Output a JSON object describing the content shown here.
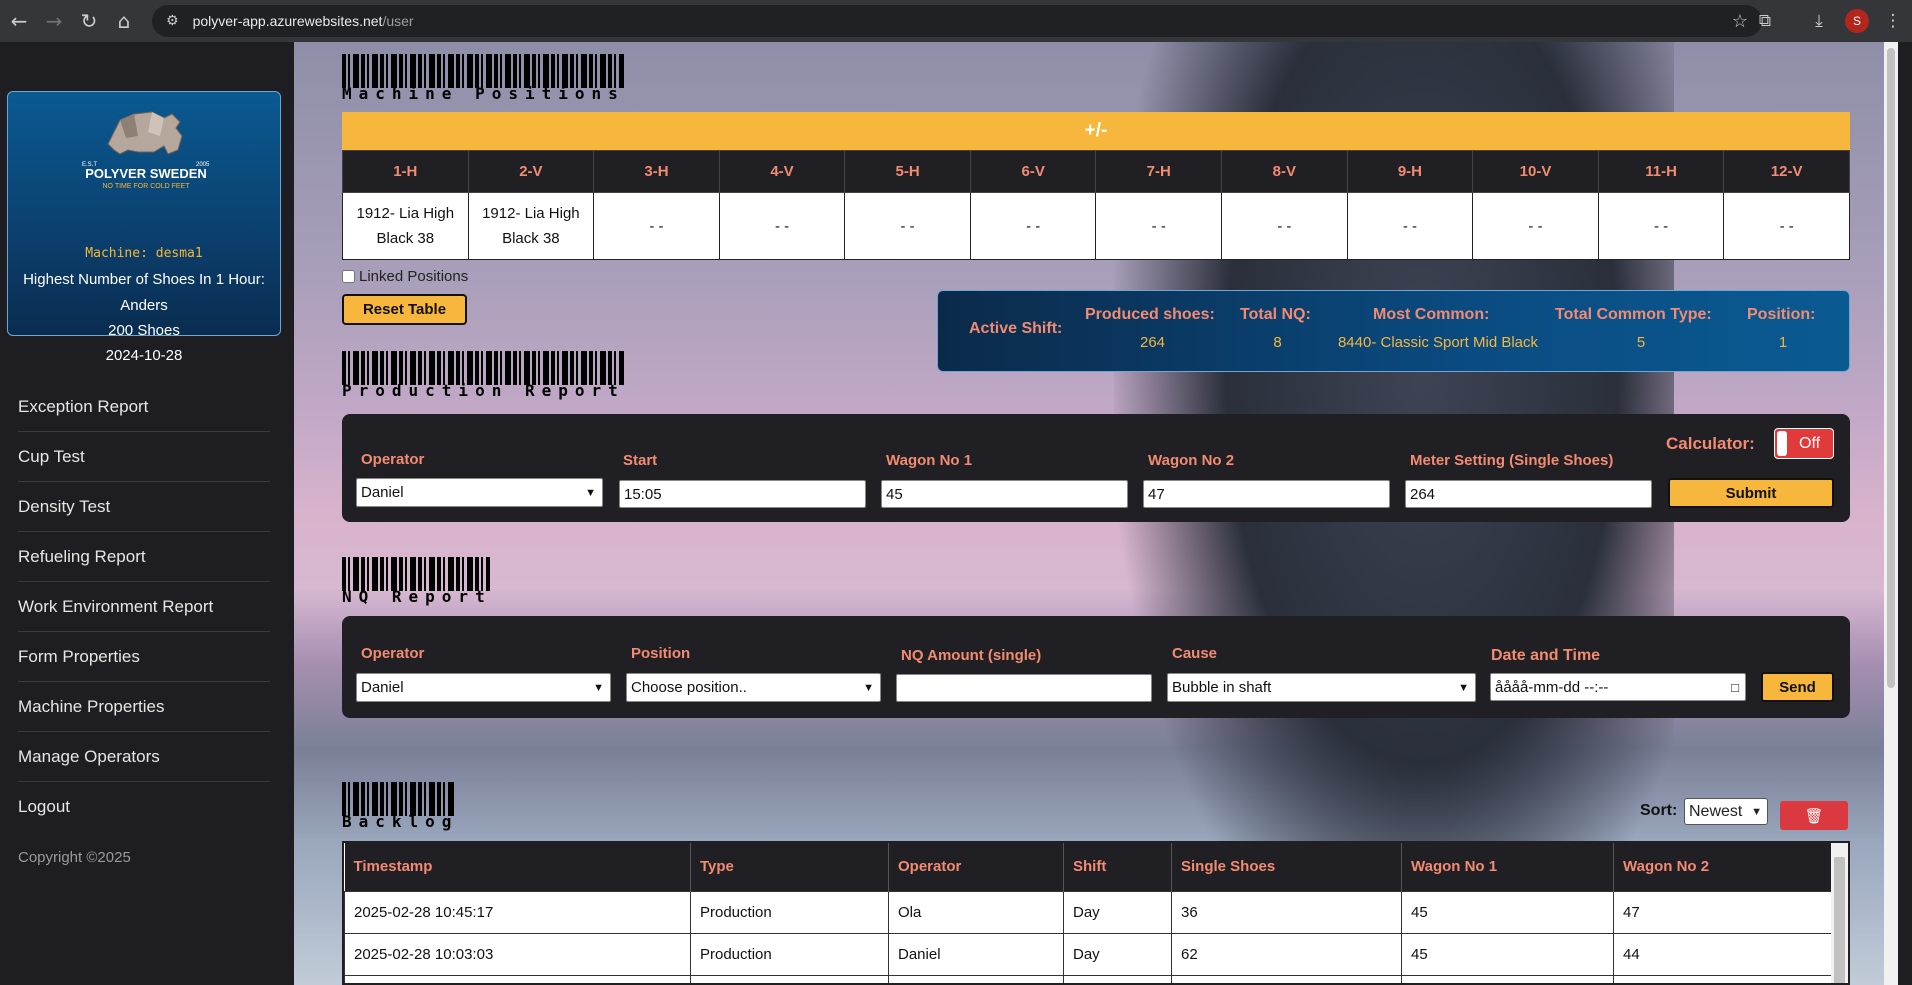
{
  "browser": {
    "url_host": "polyver-app.azurewebsites.net",
    "url_path": "/user",
    "profile_initial": "S"
  },
  "sidebar": {
    "logo_small_left": "E.S.T",
    "logo_small_right": "2005",
    "logo_text": "POLYVER SWEDEN",
    "logo_tagline": "NO TIME FOR COLD FEET",
    "machine": "Machine: desma1",
    "highscore_title": "Highest Number of Shoes In 1 Hour:",
    "highscore_name": "Anders",
    "highscore_count": "200 Shoes",
    "highscore_date": "2024-10-28",
    "menu": [
      "Exception Report",
      "Cup Test",
      "Density Test",
      "Refueling Report",
      "Work Environment Report",
      "Form Properties",
      "Machine Properties",
      "Manage Operators",
      "Logout"
    ],
    "copyright": "Copyright ©2025"
  },
  "machine_positions": {
    "heading": "Machine Positions",
    "toggle_label": "+/-",
    "columns": [
      "1-H",
      "2-V",
      "3-H",
      "4-V",
      "5-H",
      "6-V",
      "7-H",
      "8-V",
      "9-H",
      "10-V",
      "11-H",
      "12-V"
    ],
    "cells": [
      [
        "1912- Lia High",
        "Black 38"
      ],
      [
        "1912- Lia High",
        "Black 38"
      ],
      [
        "- -"
      ],
      [
        "- -"
      ],
      [
        "- -"
      ],
      [
        "- -"
      ],
      [
        "- -"
      ],
      [
        "- -"
      ],
      [
        "- -"
      ],
      [
        "- -"
      ],
      [
        "- -"
      ],
      [
        "- -"
      ]
    ],
    "linked_label": "Linked Positions",
    "reset_label": "Reset Table"
  },
  "active_shift": {
    "title": "Active Shift:",
    "produced_label": "Produced shoes:",
    "produced_value": "264",
    "nq_label": "Total NQ:",
    "nq_value": "8",
    "common_label": "Most Common:",
    "common_value": "8440- Classic Sport Mid Black",
    "common_type_label": "Total Common Type:",
    "common_type_value": "5",
    "position_label": "Position:",
    "position_value": "1"
  },
  "production": {
    "heading": "Production Report",
    "operator_label": "Operator",
    "operator_value": "Daniel",
    "start_label": "Start",
    "start_value": "15:05",
    "wagon1_label": "Wagon No 1",
    "wagon1_value": "45",
    "wagon2_label": "Wagon No 2",
    "wagon2_value": "47",
    "meter_label": "Meter Setting (Single Shoes)",
    "meter_value": "264",
    "calculator_label": "Calculator:",
    "calculator_state": "Off",
    "submit_label": "Submit"
  },
  "nq": {
    "heading": "NQ Report",
    "operator_label": "Operator",
    "operator_value": "Daniel",
    "position_label": "Position",
    "position_value": "Choose position..",
    "amount_label": "NQ Amount (single)",
    "amount_value": "",
    "cause_label": "Cause",
    "cause_value": "Bubble in shaft",
    "datetime_label": "Date and Time",
    "datetime_value": "åååå-mm-dd --:--",
    "send_label": "Send"
  },
  "backlog": {
    "heading": "Backlog",
    "sort_label": "Sort:",
    "sort_value": "Newest",
    "columns": [
      "Timestamp",
      "Type",
      "Operator",
      "Shift",
      "Single Shoes",
      "Wagon No 1",
      "Wagon No 2"
    ],
    "rows": [
      [
        "2025-02-28 10:45:17",
        "Production",
        "Ola",
        "Day",
        "36",
        "45",
        "47"
      ],
      [
        "2025-02-28 10:03:03",
        "Production",
        "Daniel",
        "Day",
        "62",
        "45",
        "44"
      ],
      [
        "",
        "",
        "",
        "",
        "",
        "",
        ""
      ]
    ]
  },
  "colors": {
    "accent_yellow": "#f6b73c",
    "label_salmon": "#f28b72",
    "panel_dark": "#1f1f24",
    "danger_red": "#d9393f",
    "shift_blue": "#0a4c82"
  }
}
